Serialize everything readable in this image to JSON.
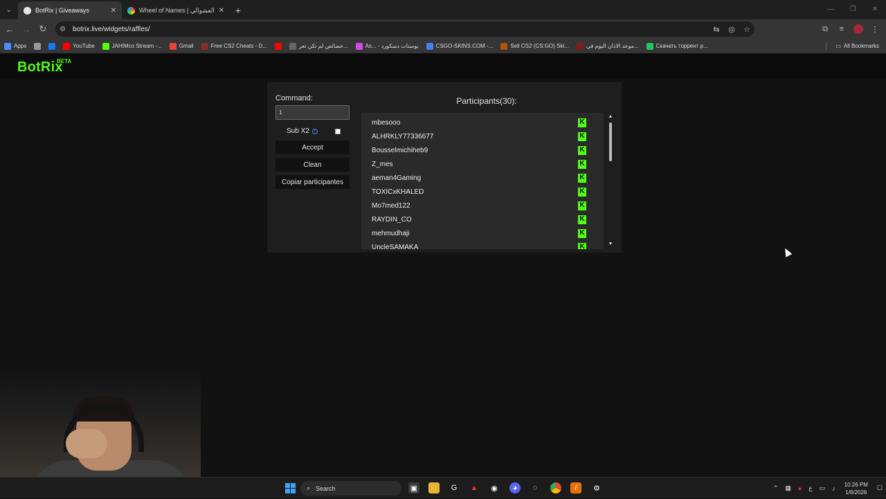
{
  "browser": {
    "tabs": [
      {
        "title": "BotRix | Giveaways",
        "active": true
      },
      {
        "title": "Wheel of Names | ﻋﺸﻮﺍﺋﻲ ﺍﺳﻢ ﺍﻟﻌﺸﻮﺍﻟﻲ",
        "active": false
      }
    ],
    "url": "botrix.live/widgets/raffles/",
    "bookmarks": [
      {
        "label": "Apps",
        "icon": "apps-grid",
        "color": "#4a8cff"
      },
      {
        "label": "",
        "icon": "grid-icon",
        "color": "#999999"
      },
      {
        "label": "",
        "icon": "facebook",
        "color": "#1877f2"
      },
      {
        "label": "YouTube",
        "icon": "youtube",
        "color": "#ff0000"
      },
      {
        "label": "JAHIMco Stream -...",
        "icon": "kick",
        "color": "#53fc18"
      },
      {
        "label": "Gmail",
        "icon": "gmail",
        "color": "#ea4335"
      },
      {
        "label": "Free CS2 Cheats - D...",
        "icon": "cheats",
        "color": "#8b2c2c"
      },
      {
        "label": "",
        "icon": "youtube",
        "color": "#ff0000"
      },
      {
        "label": "خصائص لم تكن تعر...",
        "icon": "page",
        "color": "#666666"
      },
      {
        "label": "As... - بوستات دسكورد",
        "icon": "gem",
        "color": "#d946ef"
      },
      {
        "label": "CSGO-SKINS.COM -...",
        "icon": "globe",
        "color": "#3b82f6"
      },
      {
        "label": "Sell CS2 (CS:GO) Ski...",
        "icon": "skins",
        "color": "#b45309"
      },
      {
        "label": "موعد الاذان اليوم في...",
        "icon": "adhan",
        "color": "#7f1d1d"
      },
      {
        "label": "Скачать торрент р...",
        "icon": "torrent",
        "color": "#22c55e"
      }
    ],
    "all_bookmarks": "All Bookmarks"
  },
  "site": {
    "logo": "BotRix",
    "beta": "BETA"
  },
  "raffle": {
    "command_label": "Command:",
    "command_value": "1",
    "sub_label": "Sub X2",
    "sub_checked": false,
    "accept_label": "Accept",
    "clean_label": "Clean",
    "copy_label": "Copiar participantes",
    "participants_title": "Participants(30):",
    "participants": [
      "mbesooo",
      "ALHRKLY77336677",
      "Bousselmichiheb9",
      "Z_mes",
      "aeman4Gaming",
      "TOXICxKHALED",
      "Mo7med122",
      "RAYDIN_CO",
      "mehmudhaji",
      "UncleSAMAKA"
    ],
    "platform_icon": "kick-icon",
    "platform_color": "#53fc18"
  },
  "taskbar": {
    "search_placeholder": "Search",
    "time": "10:26 PM",
    "date": "1/6/2026"
  }
}
